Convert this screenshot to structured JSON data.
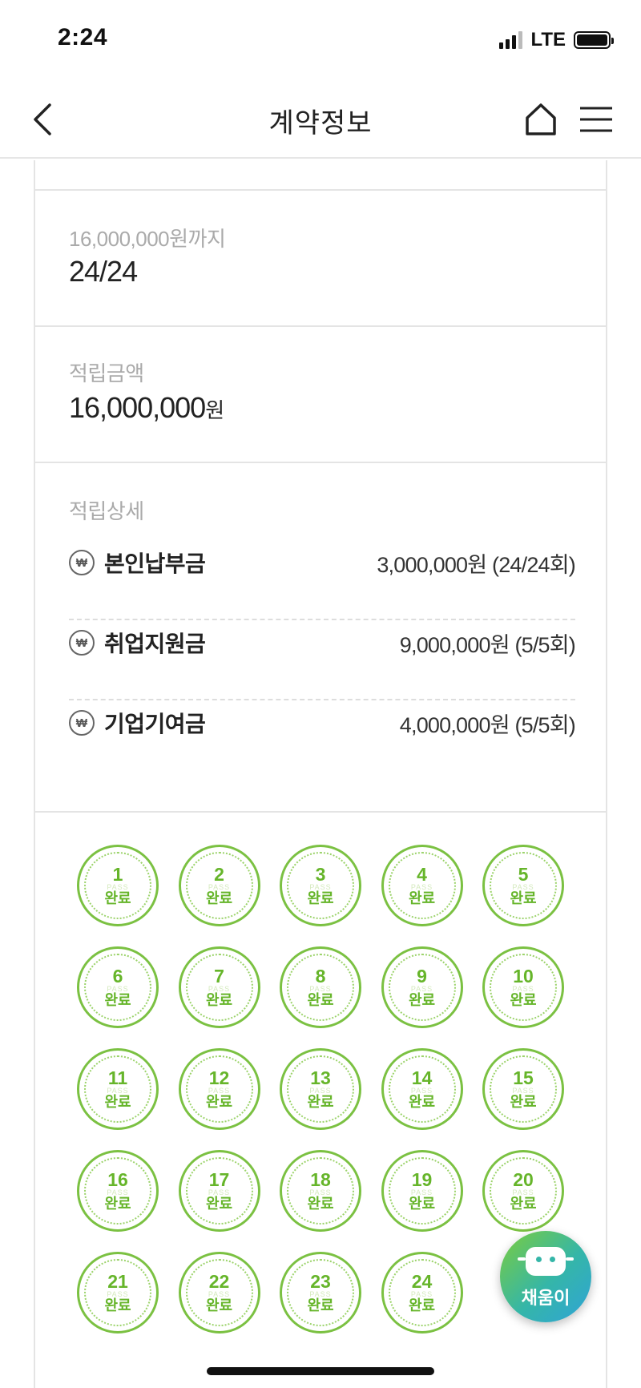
{
  "status_bar": {
    "time": "2:24",
    "network": "LTE"
  },
  "header": {
    "title": "계약정보"
  },
  "target": {
    "label": "16,000,000원까지",
    "value": "24/24"
  },
  "saved": {
    "label": "적립금액",
    "amount": "16,000,000",
    "unit": "원"
  },
  "detail": {
    "label": "적립상세",
    "icon_glyph": "₩",
    "rows": [
      {
        "name": "본인납부금",
        "amount": "3,000,000원 (24/24회)"
      },
      {
        "name": "취업지원금",
        "amount": "9,000,000원 (5/5회)"
      },
      {
        "name": "기업기여금",
        "amount": "4,000,000원 (5/5회)"
      }
    ]
  },
  "stamps": {
    "status_label": "완료",
    "watermark": "PASS",
    "color": "#66b52a",
    "items": [
      "1",
      "2",
      "3",
      "4",
      "5",
      "6",
      "7",
      "8",
      "9",
      "10",
      "11",
      "12",
      "13",
      "14",
      "15",
      "16",
      "17",
      "18",
      "19",
      "20",
      "21",
      "22",
      "23",
      "24"
    ]
  },
  "chatbot": {
    "label": "채움이"
  }
}
